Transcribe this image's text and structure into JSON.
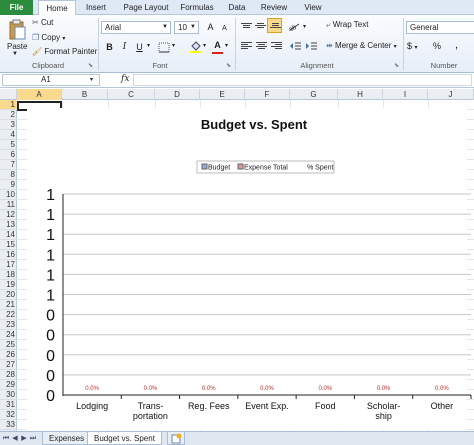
{
  "ribbon_tabs": [
    "File",
    "Home",
    "Insert",
    "Page Layout",
    "Formulas",
    "Data",
    "Review",
    "View"
  ],
  "clipboard": {
    "paste": "Paste",
    "cut": "Cut",
    "copy": "Copy",
    "format_painter": "Format Painter",
    "group": "Clipboard"
  },
  "font": {
    "family": "Arial",
    "size": "10",
    "bold": "B",
    "italic": "I",
    "underline": "U",
    "grow": "A",
    "shrink": "A",
    "color_letter": "A",
    "group": "Font"
  },
  "alignment": {
    "wrap_text": "Wrap Text",
    "merge_center": "Merge & Center",
    "group": "Alignment"
  },
  "number": {
    "format": "General",
    "currency": "$",
    "percent": "%",
    "comma": ",",
    "group": "Number"
  },
  "formula_bar": {
    "name_box": "A1",
    "fx": "fx",
    "formula": ""
  },
  "columns": [
    "A",
    "B",
    "C",
    "D",
    "E",
    "F",
    "G",
    "H",
    "I",
    "J"
  ],
  "rows": [
    "1",
    "2",
    "3",
    "4",
    "5",
    "6",
    "7",
    "8",
    "9",
    "10",
    "11",
    "12",
    "13",
    "14",
    "15",
    "16",
    "17",
    "18",
    "19",
    "20",
    "21",
    "22",
    "23",
    "24",
    "25",
    "26",
    "27",
    "28",
    "29",
    "30",
    "31",
    "32",
    "33"
  ],
  "sheets": [
    "Expenses",
    "Budget vs. Spent"
  ],
  "active_sheet": "Budget vs. Spent",
  "colors": {
    "file_tab": "#2a8c3c",
    "gridline": "#c8c8c8",
    "axis": "#222222"
  },
  "chart_data": {
    "type": "bar",
    "title": "Budget vs. Spent",
    "legend_position": "top",
    "series": [
      {
        "name": "Budget",
        "values": [
          0,
          0,
          0,
          0,
          0,
          0,
          0
        ]
      },
      {
        "name": "Expense Total",
        "values": [
          0,
          0,
          0,
          0,
          0,
          0,
          0
        ]
      },
      {
        "name": "% Spent",
        "values": [
          0,
          0,
          0,
          0,
          0,
          0,
          0
        ]
      }
    ],
    "categories": [
      "Lodging",
      "Trans- portation",
      "Reg. Fees",
      "Event Exp.",
      "Food",
      "Scholar- ship",
      "Other"
    ],
    "data_labels": [
      "0.0%",
      "0.0%",
      "0.0%",
      "0.0%",
      "0.0%",
      "0.0%",
      "0.0%"
    ],
    "y_tick_labels": [
      "1",
      "1",
      "1",
      "1",
      "1",
      "1",
      "0",
      "0",
      "0",
      "0",
      "0"
    ],
    "grid": true
  }
}
